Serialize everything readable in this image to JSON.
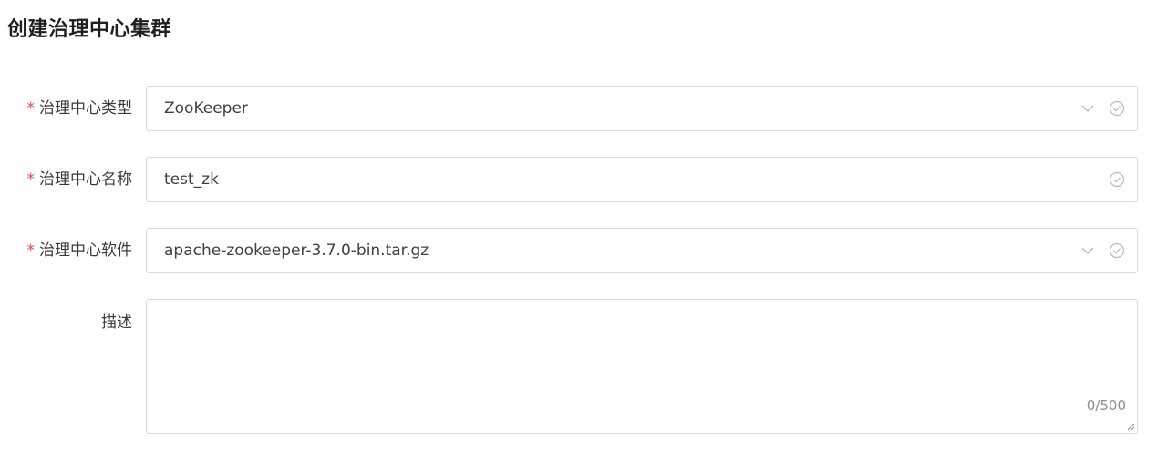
{
  "page": {
    "title": "创建治理中心集群"
  },
  "form": {
    "type_field": {
      "label": "治理中心类型",
      "required": "*",
      "value": "ZooKeeper"
    },
    "name_field": {
      "label": "治理中心名称",
      "required": "*",
      "value": "test_zk"
    },
    "software_field": {
      "label": "治理中心软件",
      "required": "*",
      "value": "apache-zookeeper-3.7.0-bin.tar.gz"
    },
    "description_field": {
      "label": "描述",
      "value": "",
      "counter": "0/500"
    }
  },
  "icons": {
    "select_arrow": "chevron-down-icon",
    "valid_status": "check-circle-icon",
    "textarea_resize": "resize-handle-icon"
  },
  "colors": {
    "required": "#e5484d",
    "border": "#d9d9d9",
    "status_icon": "#b8b8b8"
  }
}
